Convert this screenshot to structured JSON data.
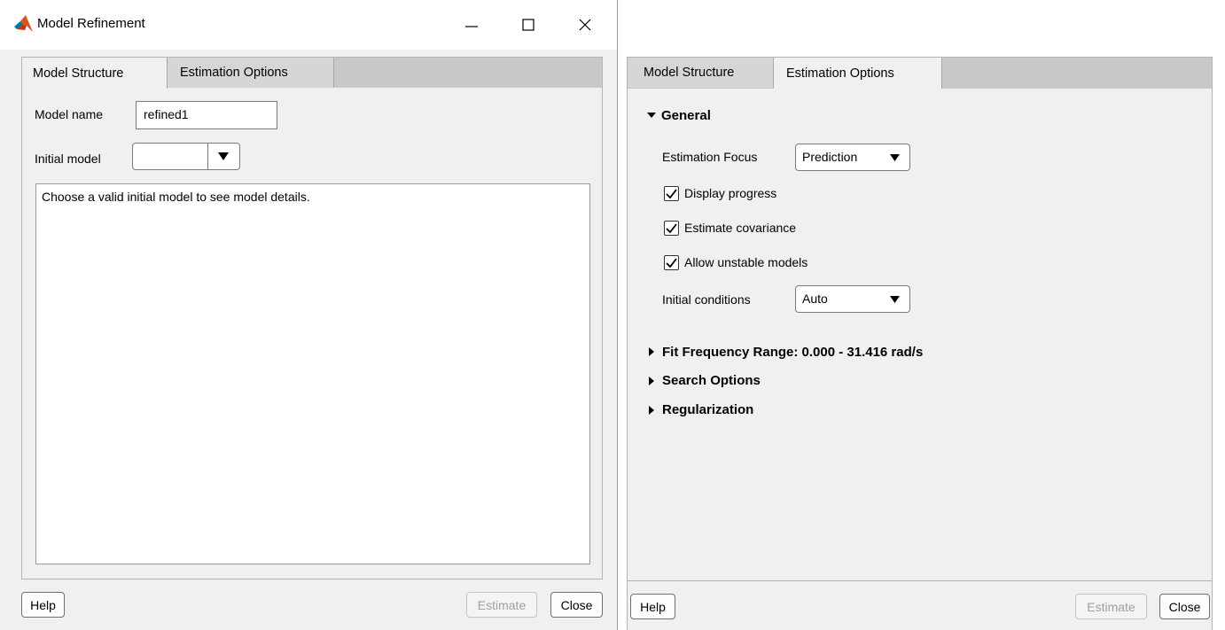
{
  "left_window": {
    "title": "Model Refinement",
    "tabs": [
      {
        "label": "Model Structure",
        "active": true
      },
      {
        "label": "Estimation Options",
        "active": false
      }
    ],
    "model_name_label": "Model name",
    "model_name_value": "refined1",
    "initial_model_label": "Initial model",
    "initial_model_value": "",
    "details_text": "Choose a valid initial model to see model details.",
    "help_label": "Help",
    "estimate_label": "Estimate",
    "close_label": "Close"
  },
  "right_panel": {
    "tabs": [
      {
        "label": "Model Structure",
        "active": false
      },
      {
        "label": "Estimation Options",
        "active": true
      }
    ],
    "general": {
      "header": "General",
      "estimation_focus_label": "Estimation Focus",
      "estimation_focus_value": "Prediction",
      "display_progress_label": "Display progress",
      "display_progress_checked": true,
      "estimate_covariance_label": "Estimate covariance",
      "estimate_covariance_checked": true,
      "allow_unstable_label": "Allow unstable models",
      "allow_unstable_checked": true,
      "initial_conditions_label": "Initial conditions",
      "initial_conditions_value": "Auto"
    },
    "collapsed_sections": {
      "fit_frequency": "Fit Frequency Range: 0.000 - 31.416 rad/s",
      "search_options": "Search Options",
      "regularization": "Regularization"
    },
    "help_label": "Help",
    "estimate_label": "Estimate",
    "close_label": "Close"
  },
  "colors": {
    "matlab_logo_primary": "#d9541e",
    "matlab_logo_secondary": "#0076a8",
    "window_bg": "#f0f0f0",
    "tab_strip": "#c8c8c8"
  }
}
